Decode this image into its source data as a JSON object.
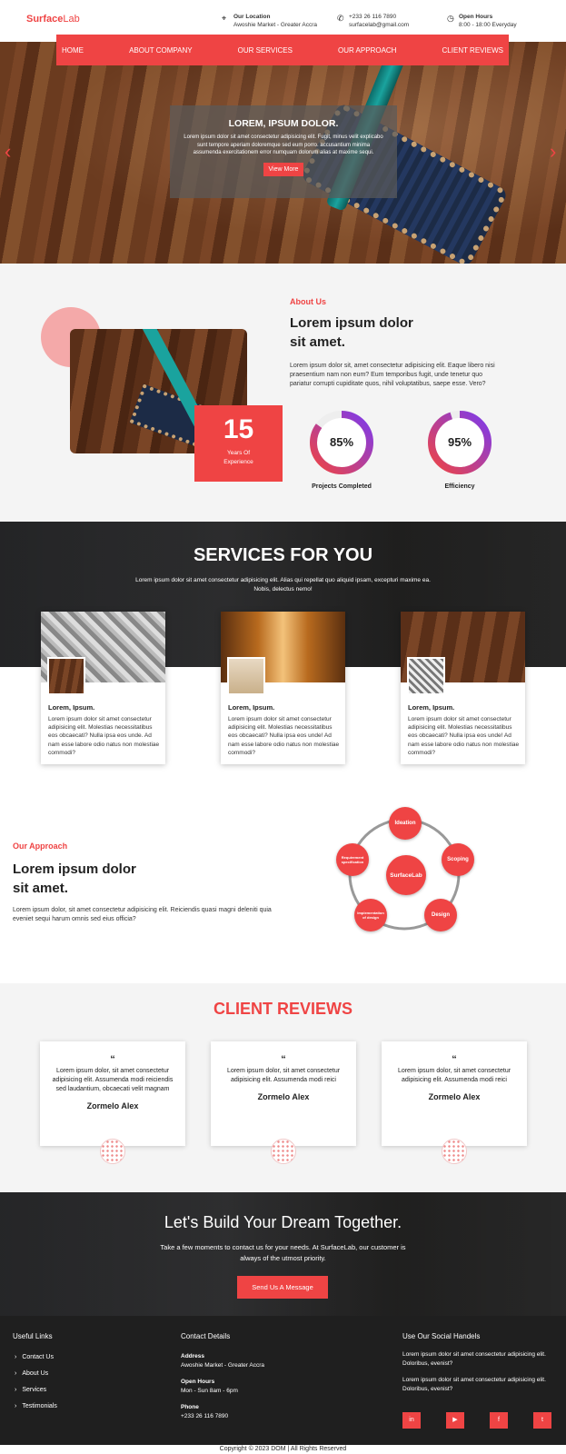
{
  "brand": {
    "logo_bold": "Surface",
    "logo_light": "Lab"
  },
  "header": {
    "location_title": "Our Location",
    "location_value": "Awoshie Market - Greater Accra",
    "phone": "+233 26 116 7890",
    "email": "surfacelab@gmail.com",
    "hours_title": "Open Hours",
    "hours_value": "8:00 - 18:00 Everyday"
  },
  "nav": [
    "HOME",
    "ABOUT COMPANY",
    "OUR SERVICES",
    "OUR APPROACH",
    "CLIENT REVIEWS"
  ],
  "hero": {
    "title": "LOREM, IPSUM DOLOR.",
    "text": "Lorem ipsum dolor sit amet consectetur adipisicing elit. Fugit, minus velit explicabo sunt tempore aperiam doloremque sed eum porro. accusantium minima assumenda exercitationem error numquam dolorum alias at maxime sequi.",
    "button": "View More"
  },
  "about": {
    "label": "About Us",
    "title_line1": "Lorem ipsum dolor",
    "title_line2": "sit amet.",
    "text": "Lorem ipsum dolor sit, amet consectetur adipisicing elit. Eaque libero nisi praesentium nam non eum? Eum temporibus fugit, unde tenetur quo pariatur corrupti cupiditate quos, nihil voluptatibus, saepe esse. Vero?",
    "experience_number": "15",
    "experience_label": "Years Of Experience",
    "stats": [
      {
        "value": "85%",
        "fraction": 0.85,
        "label": "Projects Completed"
      },
      {
        "value": "95%",
        "fraction": 0.95,
        "label": "Efficiency"
      }
    ]
  },
  "services": {
    "title": "SERVICES FOR YOU",
    "text": "Lorem ipsum dolor sit amet consectetur adipisicing elit. Alias qui repellat quo aliquid ipsam, excepturi maxime ea. Nobis, delectus nemo!",
    "cards": [
      {
        "title": "Lorem, Ipsum.",
        "text": "Lorem ipsum dolor sit amet consectetur adipisicing elit. Molestias necessitatibus eos obcaecati? Nulla ipsa eos unde. Ad nam esse labore odio natus non molestiae commodi?"
      },
      {
        "title": "Lorem, Ipsum.",
        "text": "Lorem ipsum dolor sit amet consectetur adipisicing elit. Molestias necessitatibus eos obcaecati? Nulla ipsa eos unde! Ad nam esse labore odio natus non molestiae commodi?"
      },
      {
        "title": "Lorem, Ipsum.",
        "text": "Lorem ipsum dolor sit amet consectetur adipisicing elit. Molestias necessitatibus eos obcaecati? Nulla ipsa eos unde! Ad nam esse labore odio natus non molestiae commodi?"
      }
    ]
  },
  "approach": {
    "label": "Our Approach",
    "title_line1": "Lorem ipsum dolor",
    "title_line2": "sit amet.",
    "text": "Lorem ipsum dolor, sit amet consectetur adipisicing elit. Reiciendis quasi magni deleniti quia eveniet sequi harum omnis sed eius officia?",
    "center": "SurfaceLab",
    "nodes": [
      "Ideation",
      "Scoping",
      "Design",
      "Implementation of design",
      "Requirement specification"
    ]
  },
  "reviews": {
    "title": "CLIENT REVIEWS",
    "items": [
      {
        "quote_mark": "“",
        "text": "Lorem ipsum dolor, sit amet consectetur adipisicing elit. Assumenda modi reiciendis sed laudantium, obcaecati velit magnam",
        "name": "Zormelo Alex"
      },
      {
        "quote_mark": "“",
        "text": "Lorem ipsum dolor, sit amet consectetur adipisicing elit. Assumenda modi reici",
        "name": "Zormelo Alex"
      },
      {
        "quote_mark": "“",
        "text": "Lorem ipsum dolor, sit amet consectetur adipisicing elit. Assumenda modi reici",
        "name": "Zormelo Alex"
      }
    ]
  },
  "cta": {
    "title": "Let's Build Your Dream Together.",
    "text": "Take a few moments to contact us for your needs. At SurfaceLab, our customer is always of the utmost priority.",
    "button": "Send Us A Message"
  },
  "footer": {
    "links_title": "Useful Links",
    "links": [
      "Contact Us",
      "About Us",
      "Services",
      "Testimonials"
    ],
    "contact_title": "Contact Details",
    "address_label": "Address",
    "address_value": "Awoshie Market - Greater Accra",
    "hours_label": "Open Hours",
    "hours_value": "Mon - Sun 8am - 6pm",
    "phone_label": "Phone",
    "phone_value": "+233 26 116 7890",
    "social_title": "Use Our Social Handels",
    "social_text1": "Lorem ipsum dolor sit amet consectetur adipisicing elit. Doloribus, evenist?",
    "social_text2": "Lorem ipsum dolor sit amet consectetur adipisicing elit. Doloribus, evenist?",
    "social_icons": [
      "linkedin-icon",
      "youtube-icon",
      "facebook-icon",
      "twitter-icon"
    ],
    "copyright": "Copyright © 2023 DOM | All Rights Reserved"
  },
  "colors": {
    "accent": "#ef4444",
    "gauge_start": "#ef4444",
    "gauge_end": "#7c3aed",
    "footer_bg": "#1f1f1f"
  }
}
